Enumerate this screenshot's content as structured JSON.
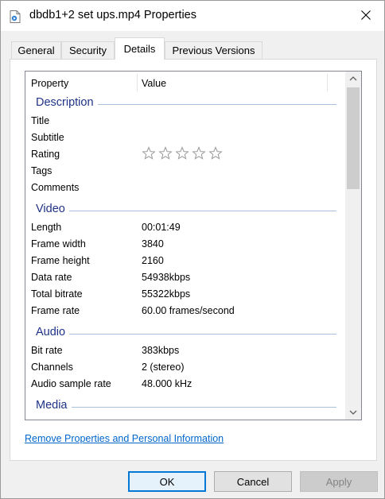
{
  "window": {
    "title": "dbdb1+2 set ups.mp4 Properties"
  },
  "tabs": [
    {
      "label": "General"
    },
    {
      "label": "Security"
    },
    {
      "label": "Details"
    },
    {
      "label": "Previous Versions"
    }
  ],
  "active_tab": "Details",
  "listview": {
    "columns": {
      "property": "Property",
      "value": "Value"
    },
    "groups": {
      "description": {
        "label": "Description",
        "rows": [
          {
            "property": "Title",
            "value": ""
          },
          {
            "property": "Subtitle",
            "value": ""
          },
          {
            "property": "Rating",
            "value": ""
          },
          {
            "property": "Tags",
            "value": ""
          },
          {
            "property": "Comments",
            "value": ""
          }
        ],
        "rating_stars": {
          "total": 5,
          "filled": 0
        }
      },
      "video": {
        "label": "Video",
        "rows": [
          {
            "property": "Length",
            "value": "00:01:49"
          },
          {
            "property": "Frame width",
            "value": "3840"
          },
          {
            "property": "Frame height",
            "value": "2160"
          },
          {
            "property": "Data rate",
            "value": "54938kbps"
          },
          {
            "property": "Total bitrate",
            "value": "55322kbps"
          },
          {
            "property": "Frame rate",
            "value": "60.00 frames/second"
          }
        ]
      },
      "audio": {
        "label": "Audio",
        "rows": [
          {
            "property": "Bit rate",
            "value": "383kbps"
          },
          {
            "property": "Channels",
            "value": "2 (stereo)"
          },
          {
            "property": "Audio sample rate",
            "value": "48.000 kHz"
          }
        ]
      },
      "media": {
        "label": "Media"
      }
    }
  },
  "remove_link": "Remove Properties and Personal Information",
  "buttons": {
    "ok": "OK",
    "cancel": "Cancel",
    "apply": "Apply"
  },
  "colors": {
    "group_header": "#1e3287",
    "link": "#0066cc",
    "focus_border": "#0078d7"
  },
  "icons": {
    "title": "video-file-icon",
    "close": "close-icon",
    "star": "star-outline-icon",
    "scroll_up": "chevron-up-icon",
    "scroll_down": "chevron-down-icon"
  }
}
